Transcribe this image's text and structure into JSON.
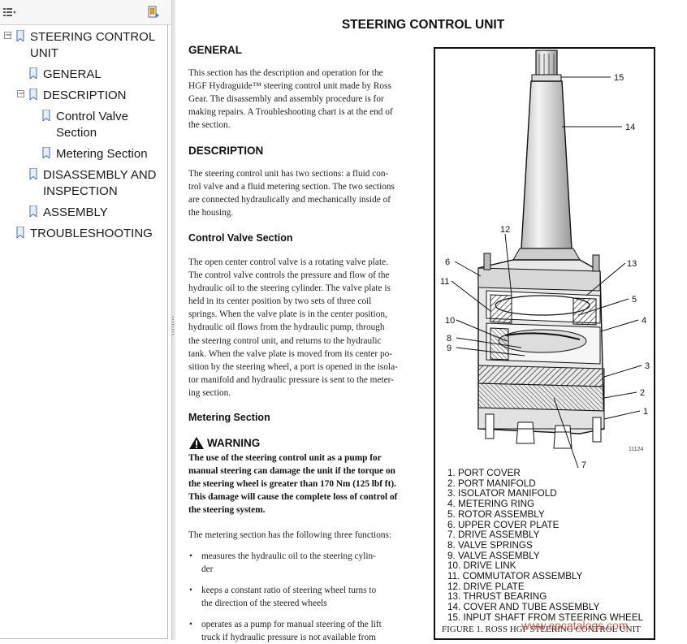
{
  "bookmarks": {
    "items": [
      {
        "label_lines": [
          "STEERING CONTROL",
          "UNIT"
        ]
      },
      {
        "label_lines": [
          "GENERAL"
        ]
      },
      {
        "label_lines": [
          "DESCRIPTION"
        ]
      },
      {
        "label_lines": [
          "Control Valve",
          "Section"
        ]
      },
      {
        "label_lines": [
          "Metering Section"
        ]
      },
      {
        "label_lines": [
          "DISASSEMBLY AND",
          "INSPECTION"
        ]
      },
      {
        "label_lines": [
          "ASSEMBLY"
        ]
      },
      {
        "label_lines": [
          "TROUBLESHOOTING"
        ]
      }
    ],
    "expander_collapse": "−"
  },
  "document": {
    "title": "STEERING CONTROL UNIT",
    "general": {
      "heading": "GENERAL",
      "lines": [
        "This section has the description and operation for the",
        "HGF Hydraguide™ steering control unit made by Ross",
        "Gear. The disassembly and assembly procedure is for",
        "making repairs. A Troubleshooting chart is at the end of",
        "the section."
      ]
    },
    "description": {
      "heading": "DESCRIPTION",
      "lines": [
        "The steering control unit has two sections: a fluid con-",
        "trol valve and a fluid metering section. The two sections",
        "are connected hydraulically and mechanically inside of",
        "the housing."
      ]
    },
    "control_valve": {
      "heading": "Control Valve Section",
      "lines": [
        "The open center control valve is a rotating valve plate.",
        "The control valve controls the pressure and flow of the",
        "hydraulic oil to the steering cylinder. The valve plate is",
        "held in its center position by two sets of three coil",
        "springs. When the valve plate is in the center position,",
        "hydraulic oil flows from the hydraulic pump, through",
        "the steering control unit, and returns to the hydraulic",
        "tank. When the valve plate is moved from its center po-",
        "sition by the steering wheel, a port is opened in the isola-",
        "tor manifold and hydraulic pressure is sent to the meter-",
        "ing section."
      ]
    },
    "metering": {
      "heading": "Metering Section",
      "warning_label": "WARNING",
      "warning_lines": [
        "The use of the steering control unit as a pump for",
        "manual steering can damage the unit if the torque on",
        "the steering wheel is greater than 170 Nm (125 lbf ft).",
        "This damage will cause the complete loss of control of",
        "the steering system."
      ],
      "intro": "The metering section has the following three functions:",
      "bullets": [
        {
          "lines": [
            "measures the hydraulic oil to the steering cylin-",
            "der"
          ]
        },
        {
          "lines": [
            "keeps a constant ratio of steering wheel turns to",
            "the direction of the steered wheels"
          ]
        },
        {
          "lines": [
            "operates as a pump for manual steering of the lift",
            "truck if hydraulic pressure is not available from"
          ]
        }
      ]
    }
  },
  "figure": {
    "callouts": [
      "1",
      "2",
      "3",
      "4",
      "5",
      "6",
      "7",
      "8",
      "9",
      "10",
      "11",
      "12",
      "13",
      "14",
      "15"
    ],
    "figure_code": "11124",
    "legend": [
      "1. PORT COVER",
      "2. PORT MANIFOLD",
      "3. ISOLATOR MANIFOLD",
      "4. METERING RING",
      "5. ROTOR ASSEMBLY",
      "6. UPPER COVER PLATE",
      "7. DRIVE ASSEMBLY",
      "8. VALVE SPRINGS",
      "9. VALVE ASSEMBLY",
      "10. DRIVE LINK",
      "11. COMMUTATOR ASSEMBLY",
      "12. DRIVE PLATE",
      "13. THRUST BEARING",
      "14. COVER AND TUBE ASSEMBLY",
      "15. INPUT SHAFT FROM STEERING WHEEL"
    ],
    "caption": "FIGURE 1. ROSS HGF STEERING CONTROL UNIT",
    "watermark": "www.epcatalogs.com"
  },
  "colors": {
    "text": "#111111",
    "watermark": "#c0392b",
    "bookmark_icon": "#4a6fa5"
  }
}
